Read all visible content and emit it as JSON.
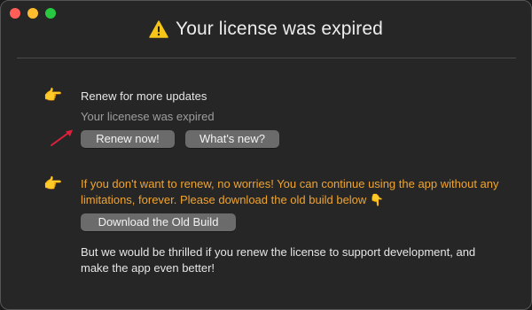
{
  "window": {
    "title": "Your license was expired",
    "title_icon": "warning-icon"
  },
  "colors": {
    "background": "#262626",
    "orange_text": "#f0a430",
    "button": "#6b6b6b",
    "arrow": "#e0203a"
  },
  "renew_section": {
    "pointer_icon": "👉",
    "title": "Renew for more updates",
    "subtitle": "Your licenese was expired",
    "renew_button": "Renew now!",
    "whats_new_button": "What's new?"
  },
  "free_section": {
    "pointer_icon": "👉",
    "message": "If you don't want to renew, no worries! You can continue using the app without any limitations, forever. Please download the old build below 👇",
    "download_button": "Download the Old Build",
    "support_message": "But we would be thrilled if you renew the license to support development, and make the app even better!"
  }
}
